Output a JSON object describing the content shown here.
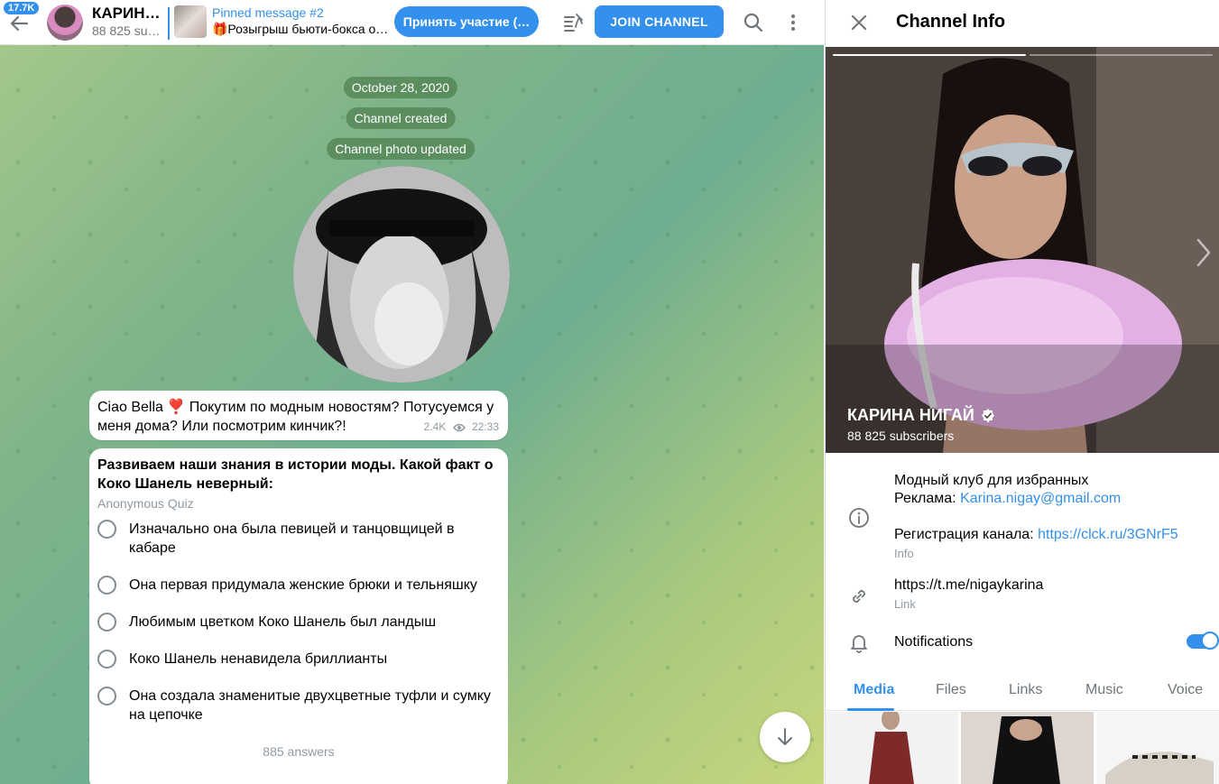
{
  "header": {
    "unread_count": "17.7K",
    "channel_title": "КАРИН…",
    "channel_subscribers": "88 825 su…",
    "pinned_title": "Pinned message #2",
    "pinned_text": "🎁Розыгрыш бьюти-бокса о…",
    "participate_label": "Принять участие (…",
    "join_label": "JOIN CHANNEL",
    "icons": [
      "back-arrow-icon",
      "unpin-list-icon",
      "search-icon",
      "more-vertical-icon"
    ]
  },
  "chat": {
    "service": {
      "date": "October 28, 2020",
      "created": "Channel created",
      "photo_updated": "Channel photo updated"
    },
    "message1": {
      "text": "Ciao Bella ❣️ Покутим по модным новостям? Потусуемся у меня дома? Или посмотрим кинчик?!",
      "views": "2.4K",
      "time": "22:33"
    },
    "quiz": {
      "question": "Развиваем наши знания в истории моды. Какой факт о Коко Шанель неверный:",
      "type": "Anonymous Quiz",
      "options": [
        "Изначально она была певицей и танцовщицей в кабаре",
        "Она первая придумала женские брюки и тельняшку",
        "Любимым цветком Коко Шанель был ландыш",
        "Коко Шанель ненавидела бриллианты",
        "Она создала знаменитые двухцветные туфли и сумку на цепочке"
      ],
      "answers": "885 answers"
    }
  },
  "info": {
    "title": "Channel Info",
    "name": "КАРИНА НИГАЙ",
    "subscribers": "88 825 subscribers",
    "description_line1": "Модный клуб для избранных",
    "ad_label": "Реклама: ",
    "ad_email": "Karina.nigay@gmail.com",
    "registration_label": "Регистрация канала: ",
    "registration_link": "https://clck.ru/3GNrF5",
    "info_caption": "Info",
    "link": "https://t.me/nigaykarina",
    "link_caption": "Link",
    "notifications": "Notifications",
    "notifications_on": true,
    "tabs": [
      "Media",
      "Files",
      "Links",
      "Music",
      "Voice"
    ],
    "active_tab": "Media"
  },
  "colors": {
    "accent": "#3390ec",
    "secondary_text": "#707579"
  }
}
